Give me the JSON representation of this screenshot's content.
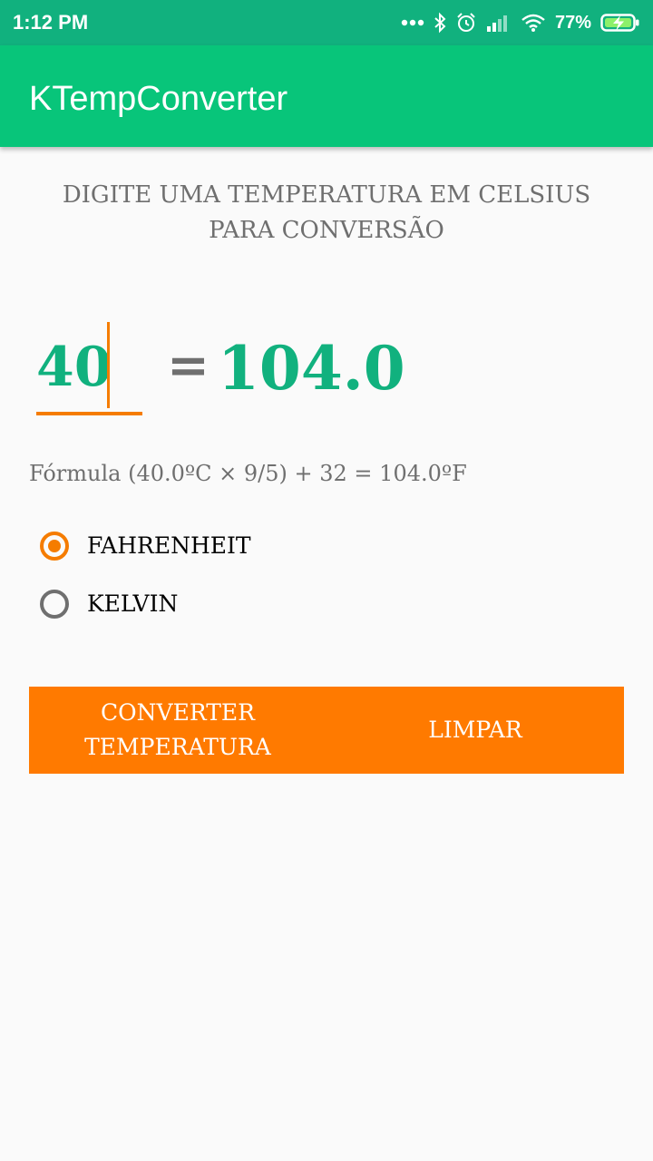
{
  "status_bar": {
    "time": "1:12 PM",
    "battery_percent": "77%",
    "icons": [
      "more-dots-icon",
      "bluetooth-icon",
      "alarm-icon",
      "signal-icon",
      "wifi-icon",
      "battery-charging-icon"
    ]
  },
  "app_bar": {
    "title": "KTempConverter"
  },
  "instructions": {
    "line1": "DIGITE UMA TEMPERATURA EM CELSIUS",
    "line2": "PARA CONVERSÃO"
  },
  "converter": {
    "input_value": "40",
    "equals_sign": "=",
    "result": "104.0"
  },
  "formula": "Fórmula (40.0ºC × 9/5) + 32 = 104.0ºF",
  "options": [
    {
      "label": "FAHRENHEIT",
      "selected": true
    },
    {
      "label": "KELVIN",
      "selected": false
    }
  ],
  "buttons": {
    "convert_label": "CONVERTER\nTEMPERATURA",
    "clear_label": "LIMPAR"
  },
  "colors": {
    "status_bar": "#11b17e",
    "app_bar": "#08c57a",
    "accent": "#f57c00",
    "button_bar": "#ff7a00",
    "result_text": "#11b17e",
    "muted_text": "#6f6f6f",
    "background": "#fafafa"
  }
}
